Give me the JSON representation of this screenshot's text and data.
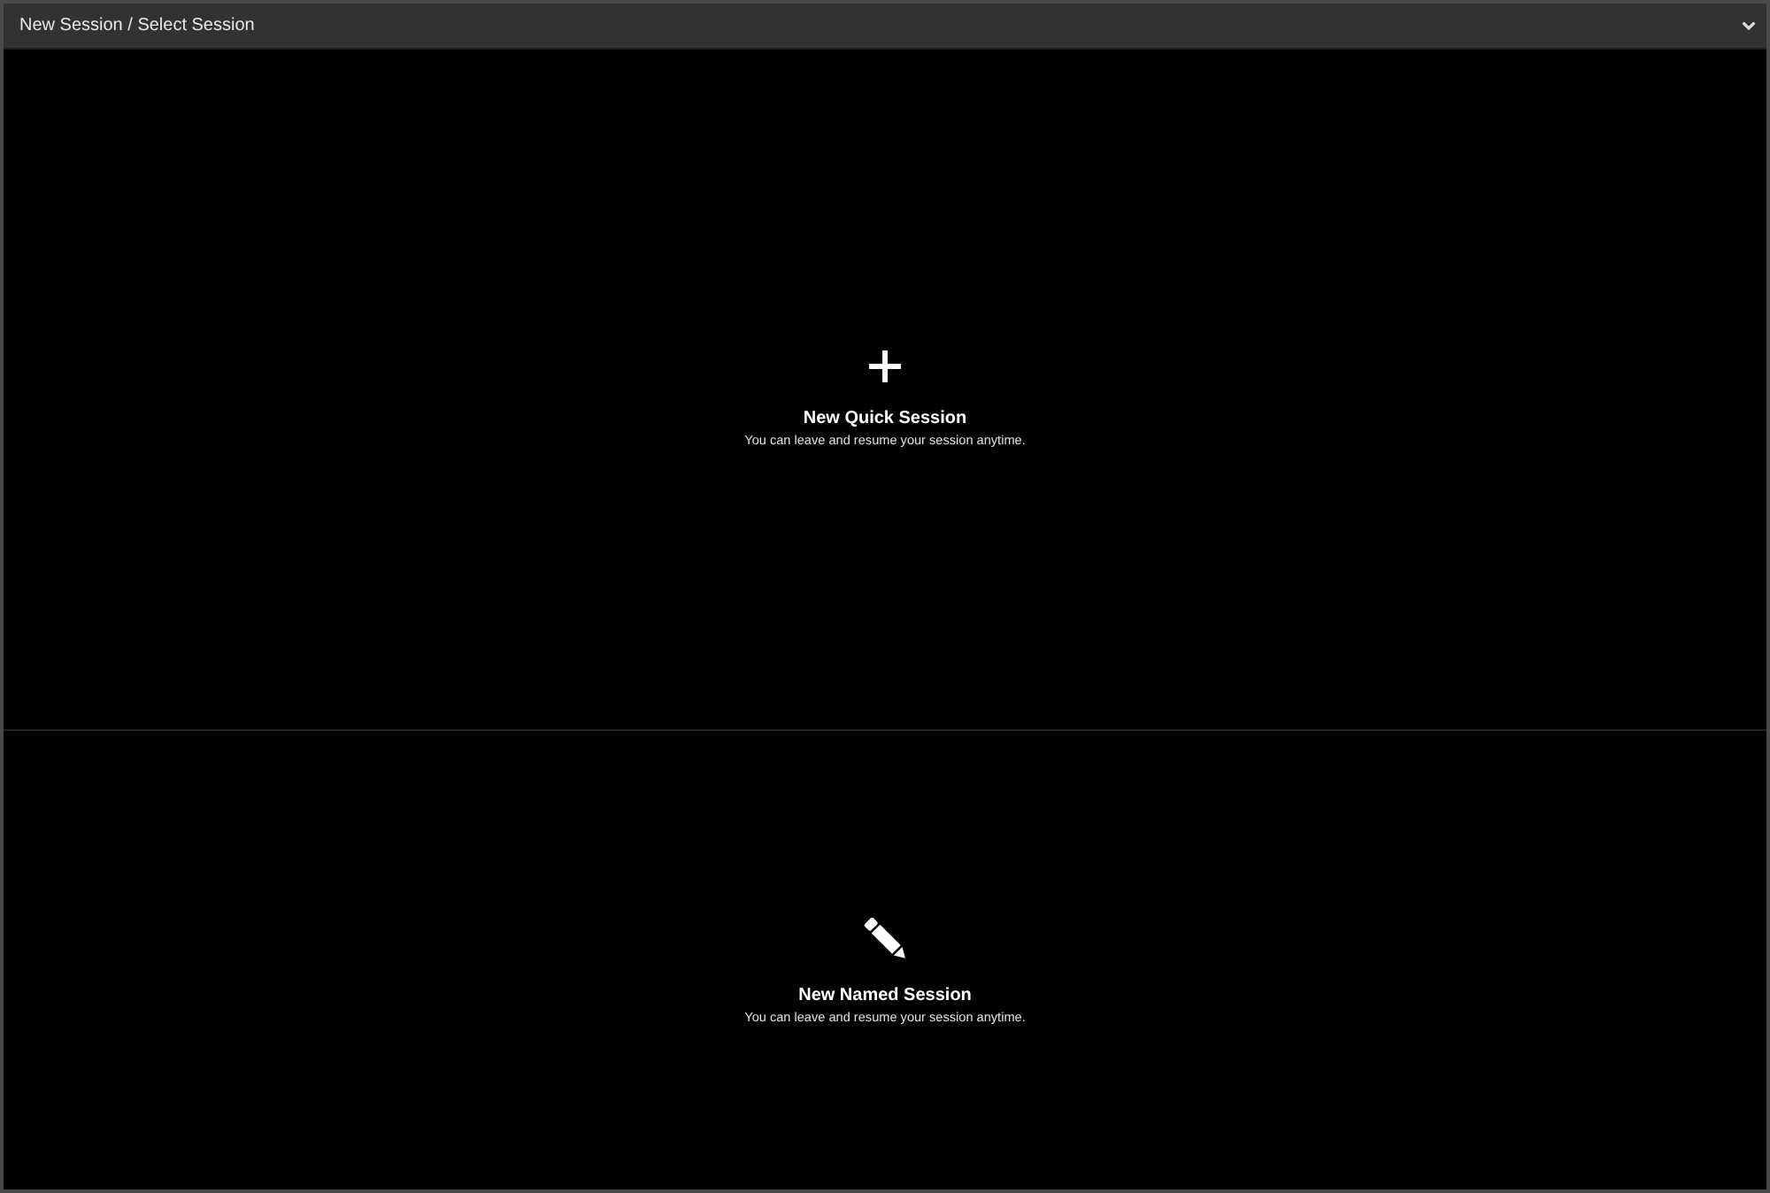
{
  "header": {
    "title": "New Session / Select Session"
  },
  "options": [
    {
      "kind": "quick",
      "title": "New Quick Session",
      "description": "You can leave and resume your session anytime."
    },
    {
      "kind": "named",
      "title": "New Named Session",
      "description": "You can leave and resume your session anytime."
    }
  ]
}
